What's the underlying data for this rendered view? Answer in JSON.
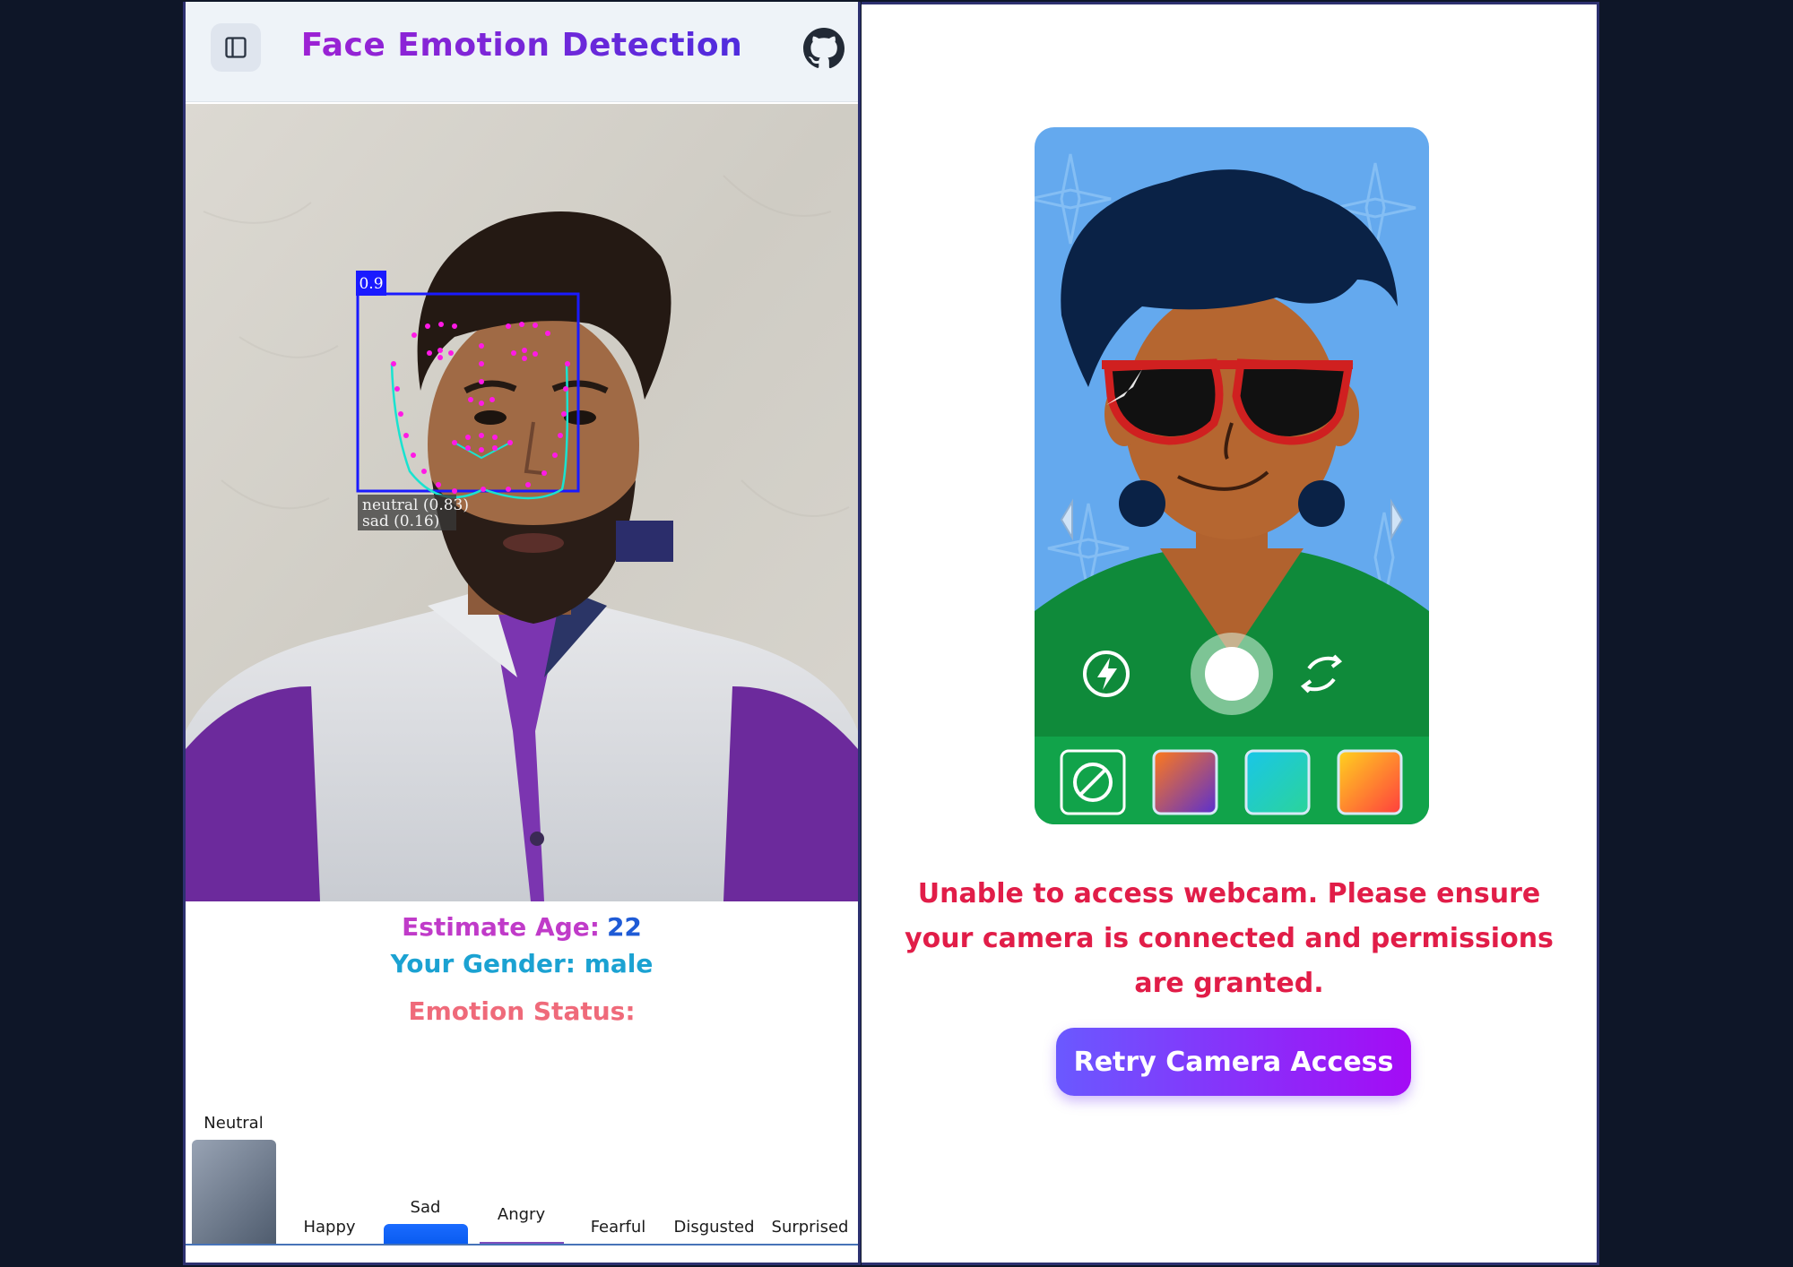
{
  "header": {
    "title": "Face Emotion Detection",
    "sidebar_toggle_icon": "sidebar-toggle-icon",
    "github_icon": "github-icon"
  },
  "detection": {
    "box_score": "0.9",
    "label_line1": "neutral (0.83)",
    "label_line2": "sad (0.16)",
    "box_color": "#1a1aff",
    "landmark_color": "#ff19e6",
    "contour_color": "#19e3d0"
  },
  "stats": {
    "age_label": "Estimate Age:",
    "age_value": "22",
    "gender_text": "Your Gender: male",
    "emotion_status_label": "Emotion Status:"
  },
  "chart_data": {
    "type": "bar",
    "categories": [
      "Neutral",
      "Happy",
      "Sad",
      "Angry",
      "Fearful",
      "Disgusted",
      "Surprised"
    ],
    "values": [
      0.83,
      0.0,
      0.16,
      0.01,
      0.0,
      0.0,
      0.0
    ],
    "bar_colors": [
      "#6b7888",
      "#1a6bff",
      "#1a6bff",
      "#7c4dbd",
      "#1a6bff",
      "#1a6bff",
      "#1a6bff"
    ],
    "title": "",
    "xlabel": "",
    "ylabel": "",
    "ylim": [
      0,
      1
    ]
  },
  "camera_error": {
    "message": "Unable to access webcam. Please ensure your camera is connected and permissions are granted.",
    "retry_label": "Retry Camera Access",
    "illustration_icons": [
      "flash-icon",
      "shutter-button-icon",
      "switch-camera-icon",
      "no-filter-icon",
      "chevron-left-icon",
      "chevron-right-icon"
    ]
  },
  "colors": {
    "error": "#e11d48",
    "retry_gradient_start": "#6a59ff",
    "retry_gradient_end": "#a40bf5",
    "page_bg": "#0e1628"
  }
}
